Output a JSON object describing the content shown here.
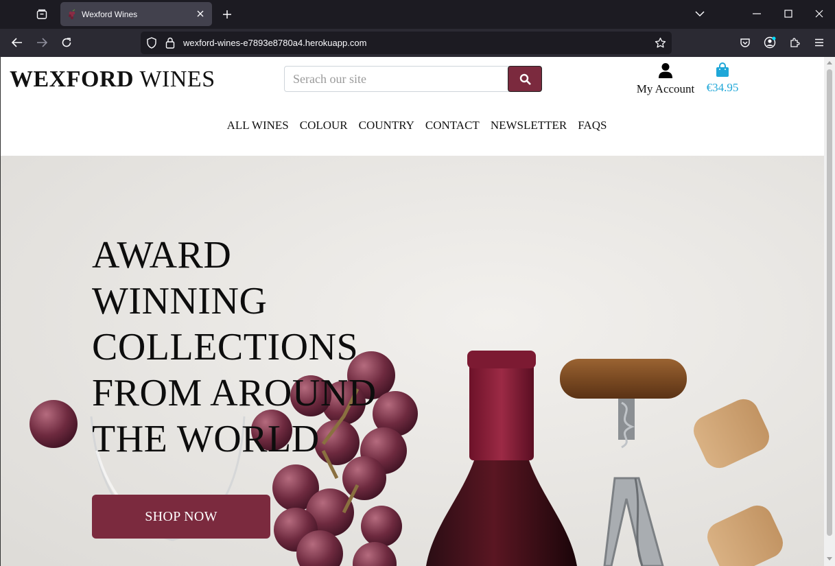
{
  "browser": {
    "tab_title": "Wexford Wines",
    "url": "wexford-wines-e7893e8780a4.herokuapp.com"
  },
  "site": {
    "logo_bold": "WEXFORD",
    "logo_light": "WINES",
    "search_placeholder": "Serach our site",
    "account_label": "My Account",
    "bag_total": "€34.95",
    "accent_color": "#7b2a3e",
    "bag_color": "#1fa7d8"
  },
  "nav": {
    "items": [
      "ALL WINES",
      "COLOUR",
      "COUNTRY",
      "CONTACT",
      "NEWSLETTER",
      "FAQS"
    ]
  },
  "hero": {
    "title_lines": [
      "AWARD",
      "WINNING",
      "COLLECTIONS",
      "FROM AROUND",
      "THE WORLD"
    ],
    "cta": "SHOP NOW"
  }
}
